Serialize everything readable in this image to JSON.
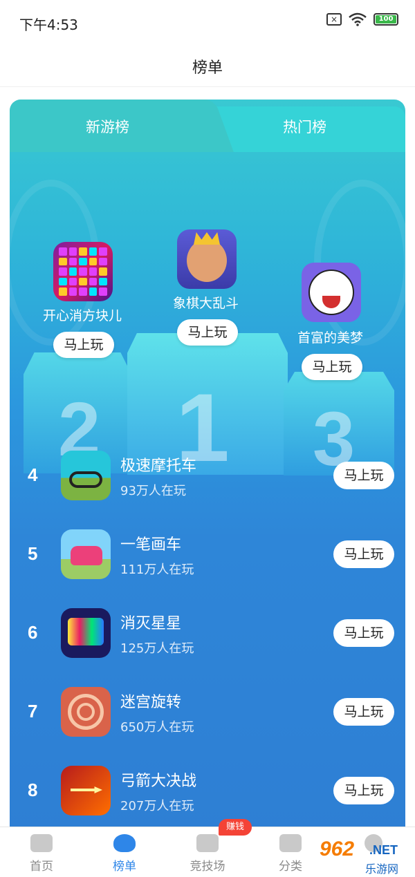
{
  "status_bar": {
    "time": "下午4:53",
    "battery": "100",
    "sim": "×"
  },
  "header": {
    "title": "榜单"
  },
  "tabs": [
    {
      "label": "新游榜",
      "active": true
    },
    {
      "label": "热门榜",
      "active": false
    }
  ],
  "podium": [
    {
      "rank": "1",
      "name": "象棋大乱斗",
      "button": "马上玩",
      "icon": "king-warrior-icon"
    },
    {
      "rank": "2",
      "name": "开心消方块儿",
      "button": "马上玩",
      "icon": "block-puzzle-icon"
    },
    {
      "rank": "3",
      "name": "首富的美梦",
      "button": "马上玩",
      "icon": "laughing-face-icon"
    }
  ],
  "list": [
    {
      "rank": "4",
      "name": "极速摩托车",
      "players": "93万人在玩",
      "button": "马上玩",
      "icon": "motorbike-icon"
    },
    {
      "rank": "5",
      "name": "一笔画车",
      "players": "111万人在玩",
      "button": "马上玩",
      "icon": "pink-car-icon"
    },
    {
      "rank": "6",
      "name": "消灭星星",
      "players": "125万人在玩",
      "button": "马上玩",
      "icon": "pop-star-icon"
    },
    {
      "rank": "7",
      "name": "迷宫旋转",
      "players": "650万人在玩",
      "button": "马上玩",
      "icon": "maze-icon"
    },
    {
      "rank": "8",
      "name": "弓箭大决战",
      "players": "207万人在玩",
      "button": "马上玩",
      "icon": "arrow-icon"
    }
  ],
  "bottom_nav": [
    {
      "label": "首页",
      "icon": "gamepad-icon",
      "active": false
    },
    {
      "label": "榜单",
      "icon": "trophy-icon",
      "active": true
    },
    {
      "label": "竞技场",
      "icon": "pk-icon",
      "active": false,
      "badge": "赚钱"
    },
    {
      "label": "分类",
      "icon": "category-grid-icon",
      "active": false
    },
    {
      "label": "",
      "icon": "profile-icon",
      "active": false
    }
  ],
  "watermark": {
    "number": "962",
    "net": ".NET",
    "site": "乐游网"
  },
  "colors": {
    "accent": "#2e86e8",
    "card_top": "#39c9d2",
    "card_bottom": "#2e7fd4",
    "badge": "#f44336"
  }
}
